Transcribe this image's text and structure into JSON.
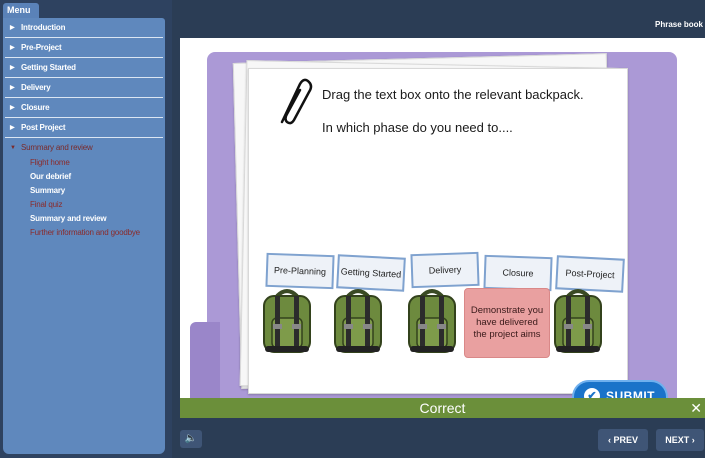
{
  "sidebar": {
    "menu_label": "Menu",
    "items": [
      {
        "label": "Introduction"
      },
      {
        "label": "Pre-Project"
      },
      {
        "label": "Getting Started"
      },
      {
        "label": "Delivery"
      },
      {
        "label": "Closure"
      },
      {
        "label": "Post Project"
      }
    ],
    "open_section": {
      "label": "Summary and review",
      "sub_items": [
        {
          "label": "Flight home",
          "state": "visited"
        },
        {
          "label": "Our debrief",
          "state": "done"
        },
        {
          "label": "Summary",
          "state": "done"
        },
        {
          "label": "Final quiz",
          "state": "visited"
        },
        {
          "label": "Summary and review",
          "state": "done"
        },
        {
          "label": "Further information and goodbye",
          "state": "visited"
        }
      ]
    }
  },
  "header": {
    "title": "Phrase book"
  },
  "activity": {
    "instruction": "Drag the text box onto the relevant backpack.",
    "question": "In which phase do you need to....",
    "labels": [
      "Pre-Planning",
      "Getting Started",
      "Delivery",
      "Closure",
      "Post-Project"
    ],
    "answer_box": "Demonstrate you have delivered the project aims",
    "submit_label": "SUBMIT"
  },
  "feedback": {
    "text": "Correct",
    "close_icon": "close-icon"
  },
  "nav": {
    "prev_label": "PREV",
    "next_label": "NEXT"
  },
  "colors": {
    "sidebar_panel": "#5f88bd",
    "folder": "#ab99d6",
    "feedback_bar": "#6b8f3a",
    "submit": "#1a73c9",
    "answer_box": "#e9a0a0"
  }
}
